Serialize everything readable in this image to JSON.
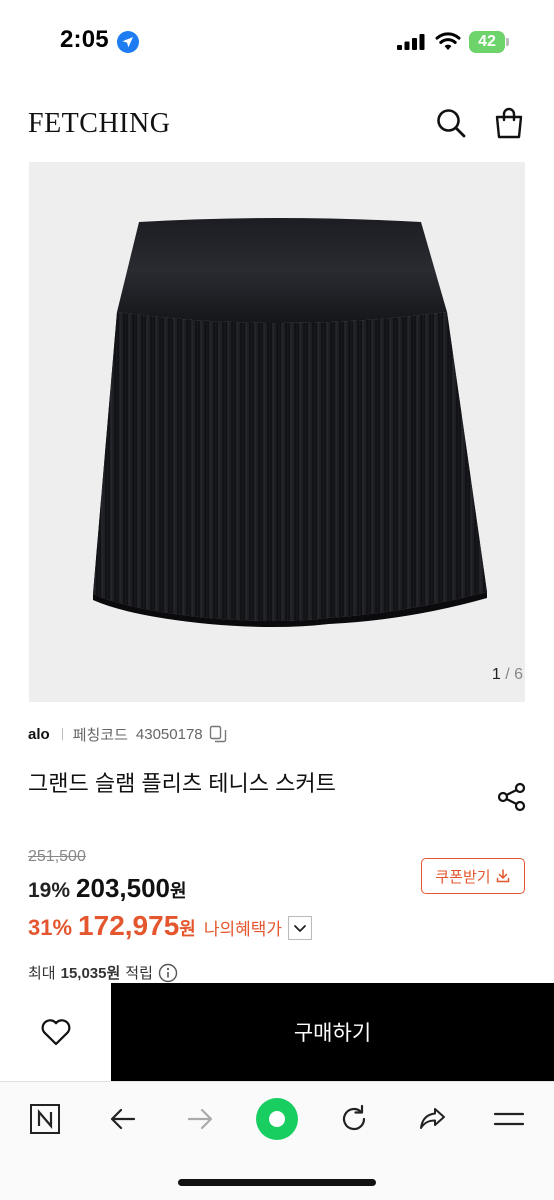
{
  "status_bar": {
    "time": "2:05",
    "battery_level": "42"
  },
  "header": {
    "brand": "FETCHING",
    "search_icon": "search-icon",
    "bag_icon": "shopping-bag-icon"
  },
  "product": {
    "image_counter": {
      "current": "1",
      "separator": " / ",
      "total": "6"
    },
    "brand": "alo",
    "code_label": "페칭코드",
    "code_value": "43050178",
    "title": "그랜드 슬램 플리츠 테니스 스커트"
  },
  "pricing": {
    "original_price": "251,500",
    "discount_1": "19%",
    "price_1": "203,500",
    "currency": "원",
    "discount_2": "31%",
    "price_2": "172,975",
    "benefit_label": "나의혜택가",
    "coupon_label": "쿠폰받기",
    "points_prefix": "최대",
    "points_value": "15,035원",
    "points_suffix": "적립"
  },
  "cta": {
    "buy_label": "구매하기"
  },
  "colors": {
    "accent": "#e4572e",
    "cta_background": "#000000",
    "browser_green": "#19ce60",
    "battery": "#6dd36b"
  },
  "browser_toolbar": {
    "items": [
      "naver-n-icon",
      "back-arrow-icon",
      "forward-arrow-icon",
      "green-dot-icon",
      "reload-icon",
      "share-arrow-icon",
      "menu-icon"
    ]
  }
}
